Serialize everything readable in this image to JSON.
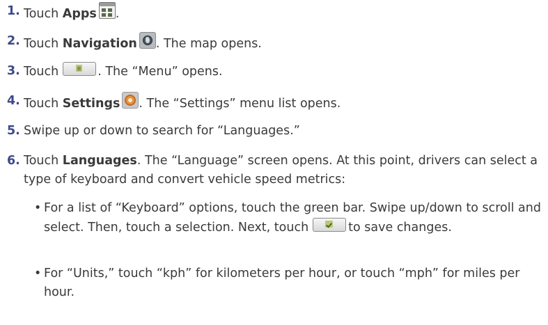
{
  "accent_color": "#3d4a8a",
  "steps": [
    {
      "number": "1.",
      "pre": "Touch ",
      "bold": "Apps",
      "icon": "apps-grid-icon",
      "post": "."
    },
    {
      "number": "2.",
      "pre": "Touch ",
      "bold": "Navigation",
      "icon": "navigation-globe-icon",
      "post": ". The map opens."
    },
    {
      "number": "3.",
      "pre": "Touch",
      "icon": "menu-list-icon",
      "post": ". The “Menu” opens."
    },
    {
      "number": "4.",
      "pre": "Touch ",
      "bold": "Settings",
      "icon": "settings-gear-icon",
      "post": ". The “Settings” menu list opens."
    },
    {
      "number": "5.",
      "text": "Swipe up or down to search for “Languages.”"
    },
    {
      "number": "6.",
      "pre": "Touch ",
      "bold": "Languages",
      "post": ". The “Language” screen opens. At this point, drivers can select a type of keyboard and convert vehicle speed metrics:"
    }
  ],
  "bullets": [
    {
      "marker": "•",
      "pre": "For a list of “Keyboard” options, touch the green bar. Swipe up/down to scroll and select. Then, touch a selection. Next, touch",
      "icon": "check-save-icon",
      "post": "to save changes."
    },
    {
      "marker": "•",
      "text": "For “Units,” touch “kph” for kilometers per hour, or touch “mph” for miles per hour."
    }
  ]
}
